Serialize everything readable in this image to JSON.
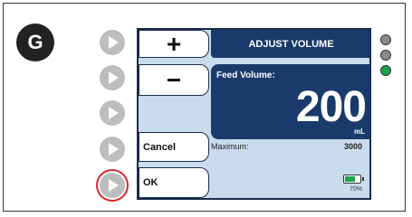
{
  "step": {
    "label": "G"
  },
  "screen": {
    "title": "ADJUST VOLUME",
    "keys": {
      "plus": "+",
      "minus": "−",
      "cancel": "Cancel",
      "ok": "OK"
    },
    "feed_volume": {
      "label": "Feed Volume:",
      "value": "200",
      "unit": "mL"
    },
    "maximum": {
      "label": "Maximum:",
      "value": "3000"
    },
    "battery": {
      "percent_label": "70%",
      "level": 0.7,
      "color": "#1ca84a"
    }
  },
  "side_buttons": {
    "count": 5,
    "highlighted_index": 4,
    "highlight_color": "#d9262d"
  },
  "indicators": [
    {
      "name": "indicator-top",
      "color": "#8a8a8a"
    },
    {
      "name": "indicator-middle",
      "color": "#8a8a8a"
    },
    {
      "name": "indicator-bottom",
      "color": "#16a34a"
    }
  ],
  "colors": {
    "screen_background": "#c9dced",
    "panel_blue": "#1a3a6b"
  }
}
